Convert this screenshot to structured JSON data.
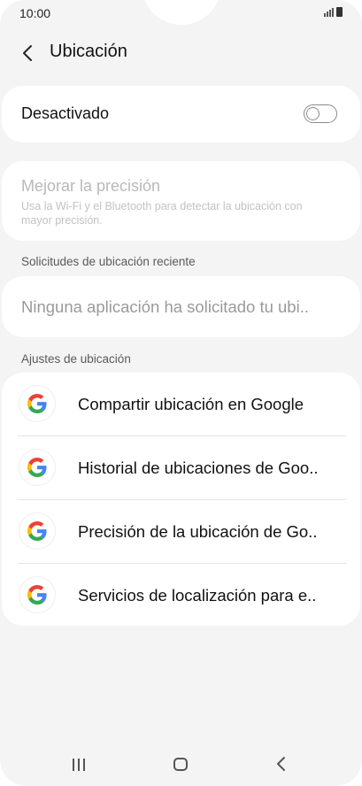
{
  "status_bar": {
    "time": "10:00",
    "signal_icon": "signal-bars-icon",
    "battery_icon": "battery-icon"
  },
  "header": {
    "back_icon": "chevron-left-icon",
    "title": "Ubicación"
  },
  "master_toggle": {
    "label": "Desactivado",
    "state": "off"
  },
  "accuracy": {
    "title": "Mejorar la precisión",
    "description": "Usa la Wi-Fi y el Bluetooth para detectar la ubicación con mayor precisión."
  },
  "recent_requests": {
    "section_label": "Solicitudes de ubicación reciente",
    "empty_text": "Ninguna aplicación ha solicitado tu ubi.."
  },
  "location_settings": {
    "section_label": "Ajustes de ubicación",
    "items": [
      {
        "icon": "google-icon",
        "label": "Compartir ubicación en Google"
      },
      {
        "icon": "google-icon",
        "label": "Historial de ubicaciones de Goo.."
      },
      {
        "icon": "google-icon",
        "label": "Precisión de la ubicación de Go.."
      },
      {
        "icon": "google-icon",
        "label": "Servicios de localización para e.."
      }
    ]
  },
  "colors": {
    "background": "#f4f4f4",
    "card": "#ffffff",
    "disabled_text": "#b9b9b9",
    "google_blue": "#4285F4",
    "google_red": "#EA4335",
    "google_yellow": "#FBBC05",
    "google_green": "#34A853"
  },
  "nav_bar": {
    "recents_icon": "recents-icon",
    "home_icon": "home-icon",
    "back_icon": "back-icon"
  }
}
